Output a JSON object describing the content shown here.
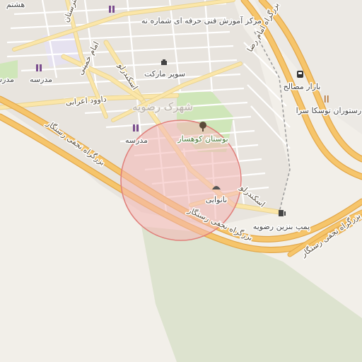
{
  "map": {
    "district": "شهرک رضویه",
    "colors": {
      "background": "#f2efe9",
      "residential": "#e8e4de",
      "motorway": "#f6c56b",
      "motorway_casing": "#e2a84c",
      "secondary": "#fbe6a8",
      "minor": "#ffffff",
      "park": "#cfe6b9",
      "hill": "#d6dec6",
      "highlight_fill": "#f4b7b4",
      "highlight_stroke": "#e07f7a"
    },
    "roads": {
      "ring_highway_1": "بزرگراه نجفی رستگار",
      "ring_highway_2": "بزرگراه نجفی رستگار",
      "ring_highway_3": "بزرگراه نجفی رستگار",
      "imam_highway": "بزرگراه امام رضا",
      "davoud": "داوود اعرابی",
      "eskandar_1": "اسکندرلو",
      "eskandar_2": "اسکندرلو",
      "imam_khomeini": "امام خمینی",
      "honarestan": "هنرستان"
    },
    "pois": [
      {
        "label": "مرکز آموزش فنی حرفه ای شماره نه",
        "icon": "school-icon"
      },
      {
        "label": "مدرسه",
        "icon": "school-icon"
      },
      {
        "label": "مدرسه",
        "icon": "school-icon"
      },
      {
        "label": "سوپر مارکت",
        "icon": "shop-icon"
      },
      {
        "label": "بوستان کوهسار",
        "icon": "park-icon"
      },
      {
        "label": "نانوایی",
        "icon": "bakery-icon"
      },
      {
        "label": "پمپ بنزین رضویه",
        "icon": "fuel-icon"
      },
      {
        "label": "بازار مصالح",
        "icon": "bus-stop-icon"
      },
      {
        "label": "رستوران توسکا سرا",
        "icon": "restaurant-icon"
      },
      {
        "label": "هشتم",
        "icon": ""
      },
      {
        "label": "مدرسه",
        "icon": ""
      }
    ]
  }
}
